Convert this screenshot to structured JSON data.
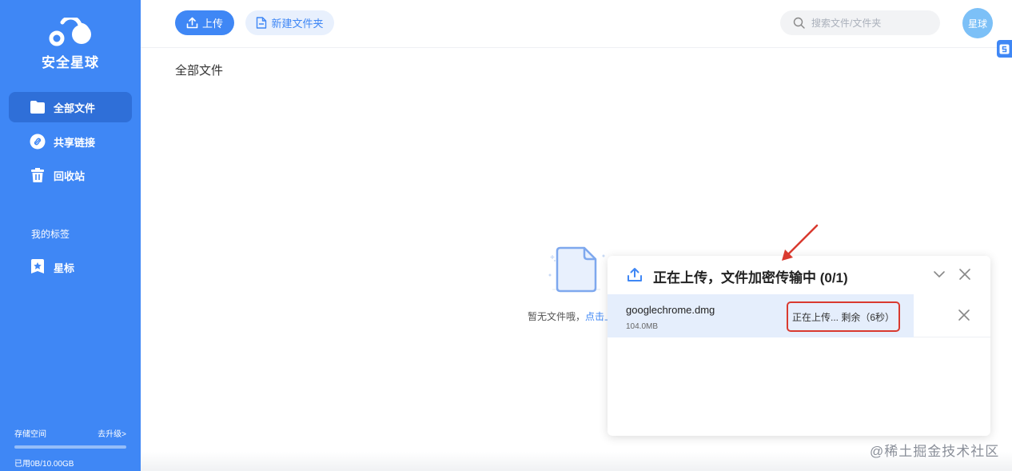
{
  "app": {
    "name": "安全星球"
  },
  "sidebar": {
    "items": [
      {
        "label": "全部文件",
        "icon": "folder-icon"
      },
      {
        "label": "共享链接",
        "icon": "link-icon"
      },
      {
        "label": "回收站",
        "icon": "trash-icon"
      }
    ],
    "section_label": "我的标签",
    "tags": [
      {
        "label": "星标",
        "icon": "star-icon"
      }
    ],
    "storage": {
      "label": "存储空间",
      "upgrade": "去升级>",
      "used_text": "已用0B/10.00GB",
      "used_fraction": 0
    }
  },
  "toolbar": {
    "upload_label": "上传",
    "new_folder_label": "新建文件夹"
  },
  "search": {
    "placeholder": "搜索文件/文件夹"
  },
  "user": {
    "avatar_text": "星球"
  },
  "main": {
    "title": "全部文件",
    "empty_text": "暂无文件哦，",
    "empty_link": "点击上传"
  },
  "upload_panel": {
    "title": "正在上传，文件加密传输中 (0/1)",
    "files": [
      {
        "name": "googlechrome.dmg",
        "size": "104.0MB",
        "status": "正在上传... 剩余（6秒）",
        "progress": 0.8
      }
    ]
  },
  "colors": {
    "primary": "#3f87f5",
    "sidebar_active": "#2f6fd8",
    "annotation": "#d93a2f"
  },
  "watermark": "@稀土掘金技术社区"
}
